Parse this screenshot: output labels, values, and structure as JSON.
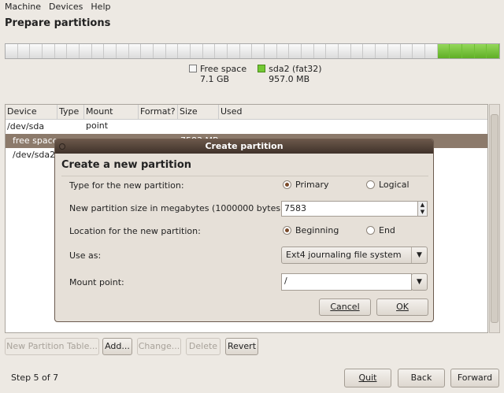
{
  "menu": [
    "Machine",
    "Devices",
    "Help"
  ],
  "page_title": "Prepare partitions",
  "partition_bar": {
    "free_fraction": 0.88,
    "used_fraction": 0.12,
    "free_color": "#f0f0f0",
    "sda2_color": "#73c934"
  },
  "legend": [
    {
      "label": "Free space",
      "size": "7.1 GB"
    },
    {
      "label": "sda2 (fat32)",
      "size": "957.0 MB"
    }
  ],
  "table": {
    "headers": [
      "Device",
      "Type",
      "Mount point",
      "Format?",
      "Size",
      "Used"
    ],
    "rows": [
      {
        "device": "/dev/sda",
        "type": "",
        "mount": "",
        "format": "",
        "size": "",
        "used": ""
      },
      {
        "device": "free space",
        "type": "",
        "mount": "",
        "format": "–",
        "size": "7583 MB",
        "used": ""
      },
      {
        "device": "/dev/sda2",
        "type": "",
        "mount": "",
        "format": "",
        "size": "",
        "used": ""
      }
    ]
  },
  "table_buttons": {
    "new_table": "New Partition Table...",
    "add": "Add...",
    "change": "Change...",
    "delete": "Delete",
    "revert": "Revert"
  },
  "step": "Step 5 of 7",
  "nav": {
    "quit": "Quit",
    "back": "Back",
    "forward": "Forward"
  },
  "dialog": {
    "title": "Create partition",
    "heading": "Create a new partition",
    "type_label": "Type for the new partition:",
    "primary": "Primary",
    "logical": "Logical",
    "type_value": "Primary",
    "size_label": "New partition size in megabytes (1000000 bytes):",
    "size_value": "7583",
    "location_label": "Location for the new partition:",
    "beginning": "Beginning",
    "end": "End",
    "location_value": "Beginning",
    "use_as_label": "Use as:",
    "use_as_value": "Ext4 journaling file system",
    "mount_label": "Mount point:",
    "mount_value": "/",
    "cancel": "Cancel",
    "ok": "OK"
  }
}
